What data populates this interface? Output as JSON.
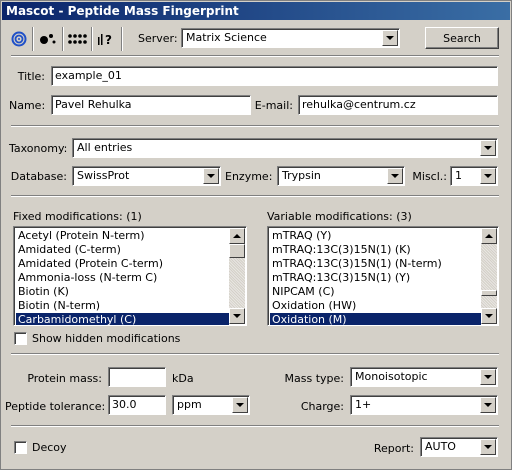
{
  "window": {
    "title": "Mascot - Peptide Mass Fingerprint"
  },
  "toolbar": {
    "server_label": "Server:",
    "server_value": "Matrix Science",
    "search_label": "Search"
  },
  "form": {
    "title_label": "Title:",
    "title_value": "example_01",
    "name_label": "Name:",
    "name_value": "Pavel Rehulka",
    "email_label": "E-mail:",
    "email_value": "rehulka@centrum.cz",
    "taxonomy_label": "Taxonomy:",
    "taxonomy_value": "All entries",
    "database_label": "Database:",
    "database_value": "SwissProt",
    "enzyme_label": "Enzyme:",
    "enzyme_value": "Trypsin",
    "miscl_label": "Miscl.:",
    "miscl_value": "1"
  },
  "fixed_mods": {
    "label": "Fixed modifications: (1)",
    "items": [
      "Acetyl (Protein N-term)",
      "Amidated (C-term)",
      "Amidated (Protein C-term)",
      "Ammonia-loss (N-term C)",
      "Biotin (K)",
      "Biotin (N-term)",
      "Carbamidomethyl (C)"
    ],
    "selected_index": 6
  },
  "variable_mods": {
    "label": "Variable modifications: (3)",
    "items": [
      "mTRAQ (Y)",
      "mTRAQ:13C(3)15N(1) (K)",
      "mTRAQ:13C(3)15N(1) (N-term)",
      "mTRAQ:13C(3)15N(1) (Y)",
      "NIPCAM (C)",
      "Oxidation (HW)",
      "Oxidation (M)"
    ],
    "selected_index": 6
  },
  "hidden_mods": {
    "label": "Show hidden modifications",
    "checked": false
  },
  "mass": {
    "protein_mass_label": "Protein mass:",
    "protein_mass_value": "",
    "protein_mass_unit": "kDa",
    "peptide_tol_label": "Peptide tolerance:",
    "peptide_tol_value": "30.0",
    "peptide_tol_unit": "ppm",
    "mass_type_label": "Mass type:",
    "mass_type_value": "Monoisotopic",
    "charge_label": "Charge:",
    "charge_value": "1+"
  },
  "footer": {
    "decoy_label": "Decoy",
    "decoy_checked": false,
    "report_label": "Report:",
    "report_value": "AUTO"
  },
  "colors": {
    "title_bar_start": "#0a246a",
    "title_bar_end": "#3a6ea5",
    "selection": "#0a246a",
    "window_bg": "#d4d0c8"
  },
  "icons": [
    "spiral-icon",
    "dots-cluster-icon",
    "dots-grid-icon",
    "help-icon",
    "dropdown-arrow-icon",
    "scroll-up-icon",
    "scroll-down-icon"
  ]
}
